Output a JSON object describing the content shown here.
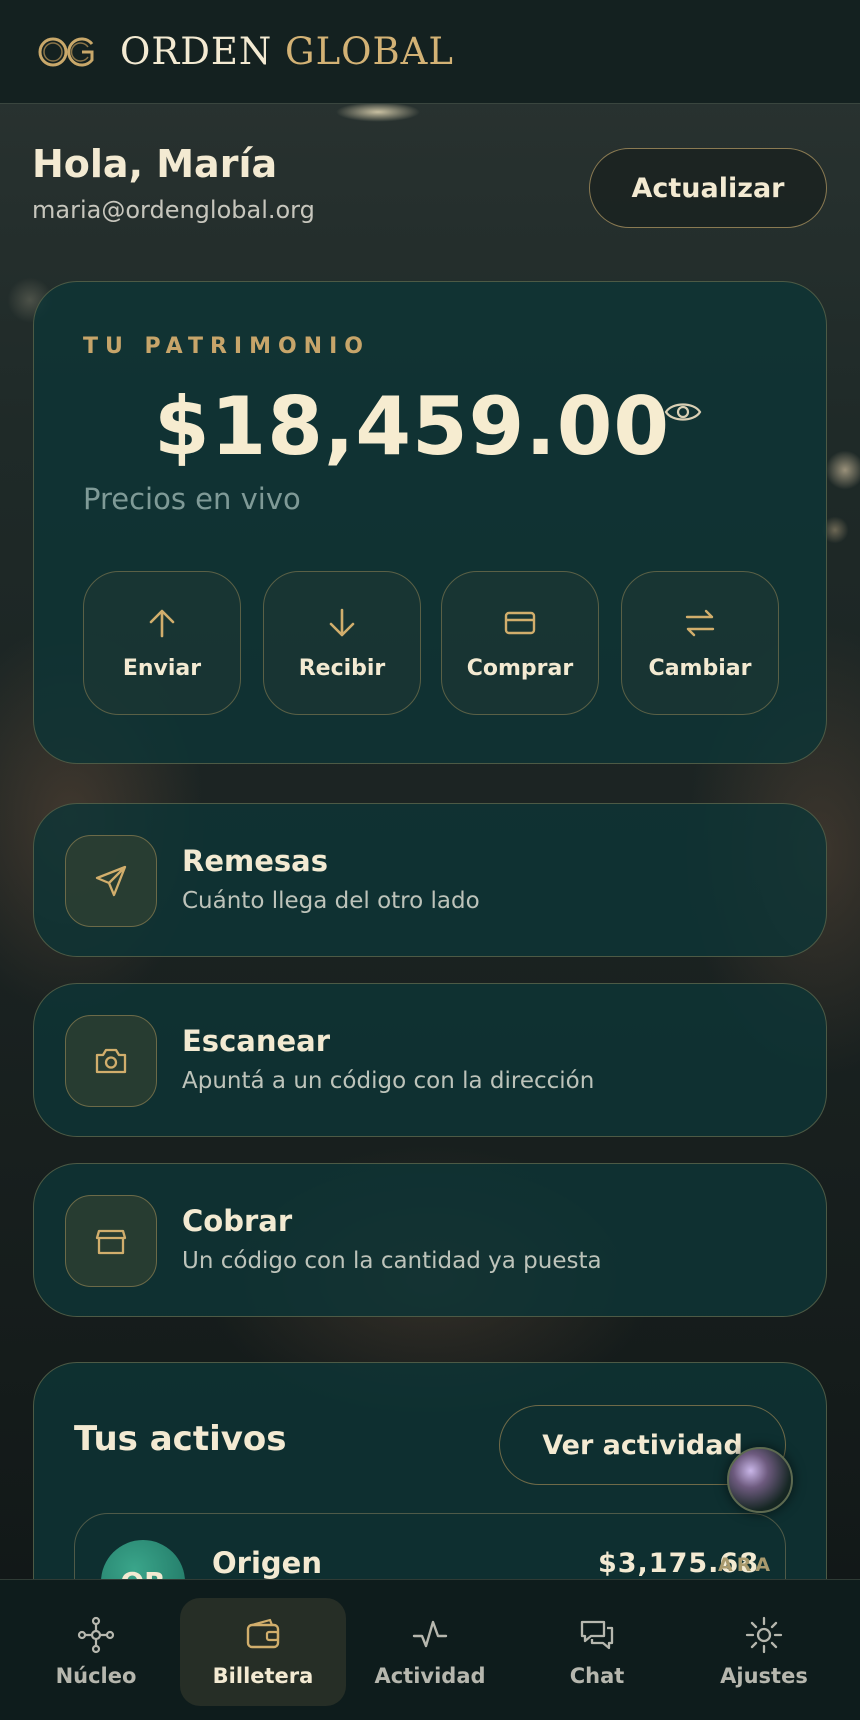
{
  "header": {
    "logo_icon": "og-monogram",
    "brand_first": "ORDEN",
    "brand_second": "GLOBAL"
  },
  "greeting": {
    "title": "Hola, María",
    "email": "maria@ordenglobal.org",
    "refresh_label": "Actualizar"
  },
  "balance": {
    "eyebrow": "TU PATRIMONIO",
    "amount": "$18,459.00",
    "visibility_icon": "eye-icon",
    "subtitle": "Precios en vivo",
    "actions": [
      {
        "label": "Enviar",
        "icon": "arrow-up-icon"
      },
      {
        "label": "Recibir",
        "icon": "arrow-down-icon"
      },
      {
        "label": "Comprar",
        "icon": "credit-card-icon"
      },
      {
        "label": "Cambiar",
        "icon": "swap-icon"
      }
    ]
  },
  "features": [
    {
      "title": "Remesas",
      "subtitle": "Cuánto llega del otro lado",
      "icon": "paper-plane-icon"
    },
    {
      "title": "Escanear",
      "subtitle": "Apuntá a un código con la dirección",
      "icon": "camera-icon"
    },
    {
      "title": "Cobrar",
      "subtitle": "Un código con la cantidad ya puesta",
      "icon": "archive-box-icon"
    }
  ],
  "assets": {
    "title": "Tus activos",
    "view_activity_label": "Ver actividad",
    "items": [
      {
        "avatar": "OR",
        "name": "Origen",
        "value": "$3,175.68"
      }
    ]
  },
  "assistant": {
    "caption": "ARA"
  },
  "nav": [
    {
      "label": "Núcleo",
      "icon": "network-icon",
      "active": false
    },
    {
      "label": "Billetera",
      "icon": "wallet-icon",
      "active": true
    },
    {
      "label": "Actividad",
      "icon": "pulse-icon",
      "active": false
    },
    {
      "label": "Chat",
      "icon": "chat-bubbles-icon",
      "active": false
    },
    {
      "label": "Ajustes",
      "icon": "sun-gear-icon",
      "active": false
    }
  ],
  "colors": {
    "accent_gold": "#d3b275",
    "card_teal": "#0e3436",
    "text_cream": "#f3ead2"
  }
}
